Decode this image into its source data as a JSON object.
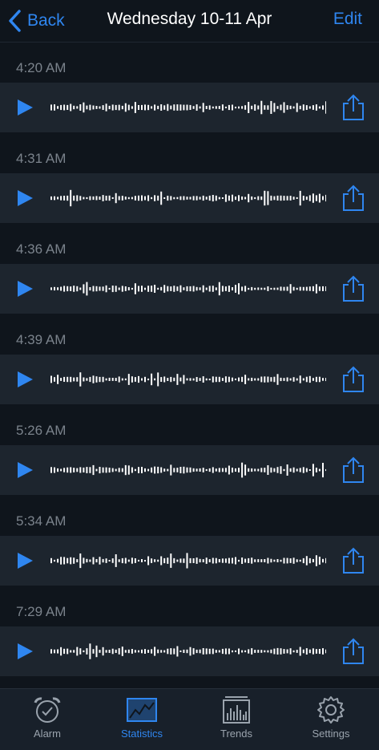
{
  "nav": {
    "back_label": "Back",
    "title": "Wednesday 10-11 Apr",
    "edit_label": "Edit"
  },
  "recordings": [
    {
      "time": "4:20 AM"
    },
    {
      "time": "4:31 AM"
    },
    {
      "time": "4:36 AM"
    },
    {
      "time": "4:39 AM"
    },
    {
      "time": "5:26 AM"
    },
    {
      "time": "5:34 AM"
    },
    {
      "time": "7:29 AM"
    }
  ],
  "tabs": [
    {
      "label": "Alarm",
      "icon": "alarm-clock-icon"
    },
    {
      "label": "Statistics",
      "icon": "statistics-chart-icon",
      "active": true
    },
    {
      "label": "Trends",
      "icon": "trends-bars-icon"
    },
    {
      "label": "Settings",
      "icon": "gear-icon"
    }
  ],
  "colors": {
    "accent": "#2f86f0",
    "background": "#0f151c",
    "row": "#1d252e",
    "time_text": "#7b838c"
  }
}
